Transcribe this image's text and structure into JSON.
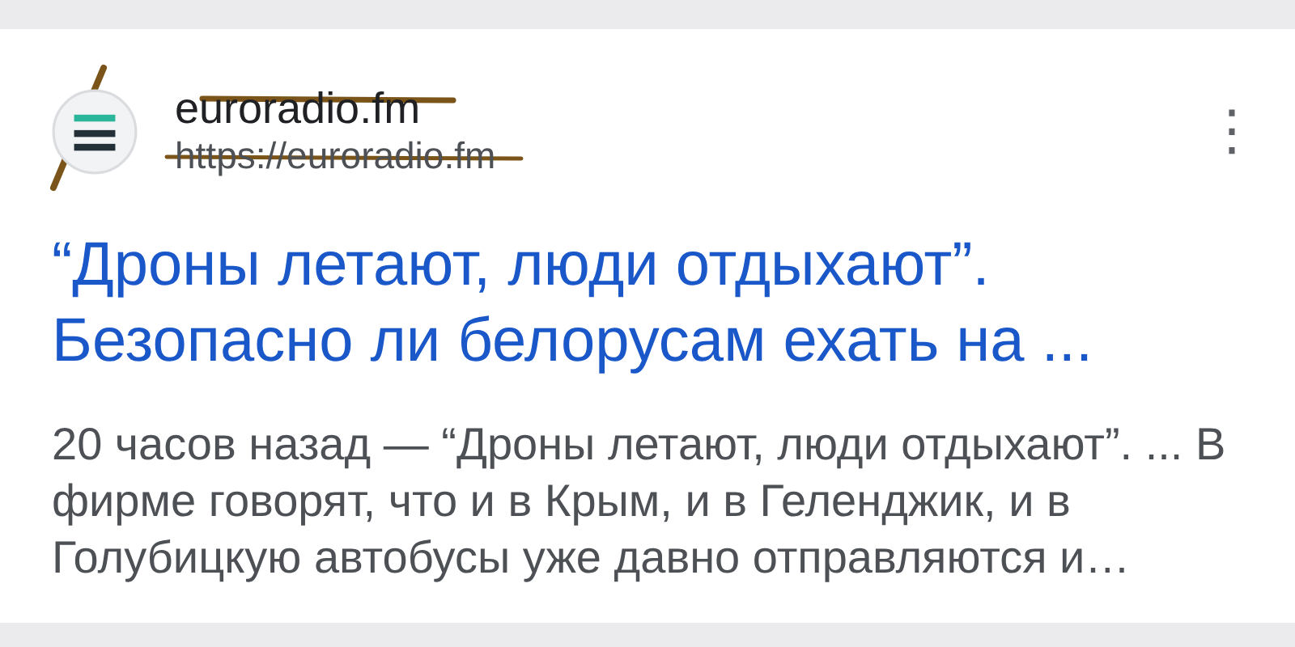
{
  "result": {
    "site_name": "euroradio.fm",
    "url": "https://euroradio.fm",
    "menu_icon": "⋮",
    "title": "“Дроны летают, люди отдыхают”. Безопасно ли белорусам ехать на ...",
    "snippet_time": "20 часов назад",
    "snippet_separator": "—",
    "snippet": "“Дроны летают, люди отдыхают”. ... В фирме говорят, что и в Крым, и в Геленджик, и в Голубицкую автобусы уже давно отправляются и…"
  }
}
